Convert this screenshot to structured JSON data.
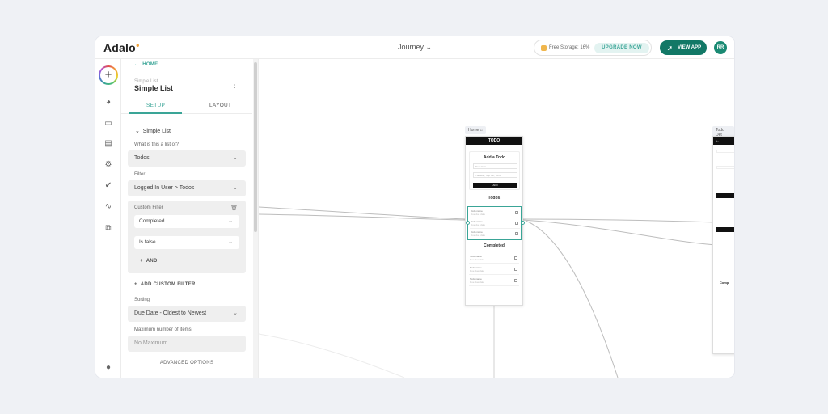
{
  "topbar": {
    "logo": "Adalo",
    "app_name": "Journey",
    "storage_text": "Free Storage: 16%",
    "upgrade_label": "UPGRADE NOW",
    "view_app_label": "VIEW APP",
    "avatar_initials": "RR"
  },
  "panel": {
    "back_label": "HOME",
    "component_type": "Simple List",
    "component_name": "Simple List",
    "tabs": [
      "SETUP",
      "LAYOUT"
    ],
    "section_title": "Simple List",
    "list_of_label": "What is this a list of?",
    "list_of_value": "Todos",
    "filter_label": "Filter",
    "filter_value": "Logged In User > Todos",
    "custom_filter_label": "Custom Filter",
    "custom_filter_field": "Completed",
    "custom_filter_op": "Is false",
    "and_label": "AND",
    "add_custom_filter_label": "ADD CUSTOM FILTER",
    "sorting_label": "Sorting",
    "sorting_value": "Due Date - Oldest to Newest",
    "max_items_label": "Maximum number of items",
    "max_items_placeholder": "No Maximum",
    "advanced_label": "ADVANCED OPTIONS"
  },
  "canvas": {
    "screen1": {
      "label": "Home",
      "title": "TODO",
      "add_card_title": "Add a Todo",
      "input1": "Todo Item",
      "input2": "Tuesday, Sep 6th, 2016",
      "button": "ADD",
      "todos_header": "Todos",
      "completed_header": "Completed",
      "row_name": "Todo name",
      "row_date": "Due due date"
    },
    "screen2": {
      "label": "Todo Det"
    }
  },
  "colors": {
    "accent": "#3aa597",
    "brand_dark": "#127866",
    "background": "#eff1f5"
  }
}
